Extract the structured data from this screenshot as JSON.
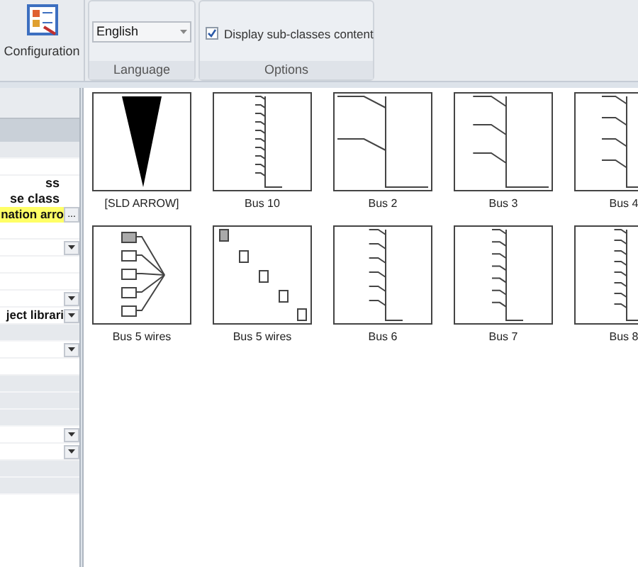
{
  "ribbon": {
    "configuration": {
      "label": "Configuration"
    },
    "language": {
      "value": "English",
      "group_label": "Language"
    },
    "options": {
      "checkbox": {
        "label": "Display sub-classes content",
        "checked": true
      },
      "group_label": "Options"
    }
  },
  "properties": [
    {
      "kind": "category"
    },
    {
      "kind": "blank"
    },
    {
      "kind": "text",
      "text": "ss"
    },
    {
      "kind": "text",
      "text": "se class"
    },
    {
      "kind": "highlight",
      "text": "nation arro",
      "button": "..."
    },
    {
      "kind": "blank"
    },
    {
      "kind": "dropdown"
    },
    {
      "kind": "blank"
    },
    {
      "kind": "blank"
    },
    {
      "kind": "dropdown"
    },
    {
      "kind": "dropdown",
      "text": "ject librari"
    },
    {
      "kind": "category"
    },
    {
      "kind": "dropdown"
    },
    {
      "kind": "blank"
    },
    {
      "kind": "category"
    },
    {
      "kind": "category"
    },
    {
      "kind": "category"
    },
    {
      "kind": "dropdown"
    },
    {
      "kind": "dropdown"
    },
    {
      "kind": "category"
    },
    {
      "kind": "category"
    }
  ],
  "gallery": [
    {
      "label": "[SLD ARROW]",
      "kind": "arrow"
    },
    {
      "label": "Bus 10",
      "kind": "bus10"
    },
    {
      "label": "Bus 2",
      "kind": "bus2"
    },
    {
      "label": "Bus 3",
      "kind": "bus3"
    },
    {
      "label": "Bus 4",
      "kind": "bus4"
    },
    {
      "label": "Bus 5 wires",
      "kind": "wires"
    },
    {
      "label": "Bus 5 wires",
      "kind": "diagonal"
    },
    {
      "label": "Bus 6",
      "kind": "bus6"
    },
    {
      "label": "Bus 7",
      "kind": "bus7"
    },
    {
      "label": "Bus 8",
      "kind": "bus8"
    }
  ]
}
